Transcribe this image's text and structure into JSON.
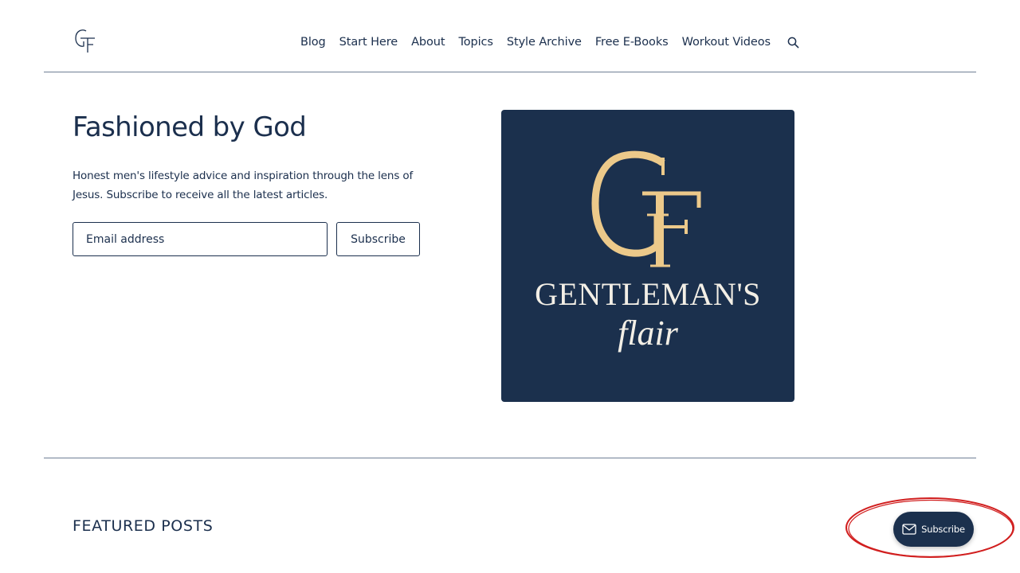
{
  "header": {
    "logo_icon": "gf-monogram-icon",
    "nav": [
      {
        "label": "Blog"
      },
      {
        "label": "Start Here"
      },
      {
        "label": "About"
      },
      {
        "label": "Topics"
      },
      {
        "label": "Style Archive"
      },
      {
        "label": "Free E-Books"
      },
      {
        "label": "Workout Videos"
      }
    ],
    "search_icon": "search-icon"
  },
  "hero": {
    "title": "Fashioned by God",
    "description": "Honest men's lifestyle advice and inspiration through the lens of Jesus. Subscribe to receive all the latest articles.",
    "email_placeholder": "Email address",
    "subscribe_label": "Subscribe"
  },
  "brand_card": {
    "monogram": "GF",
    "line1": "GENTLEMAN'S",
    "line2": "flair",
    "background": "#1b304d",
    "gold": "#ecc98a",
    "cream": "#f3efe6"
  },
  "featured": {
    "title": "FEATURED POSTS"
  },
  "floating_subscribe": {
    "icon": "envelope-icon",
    "label": "Subscribe"
  },
  "colors": {
    "text": "#1b2f4d",
    "annotation": "#d11f1f"
  }
}
